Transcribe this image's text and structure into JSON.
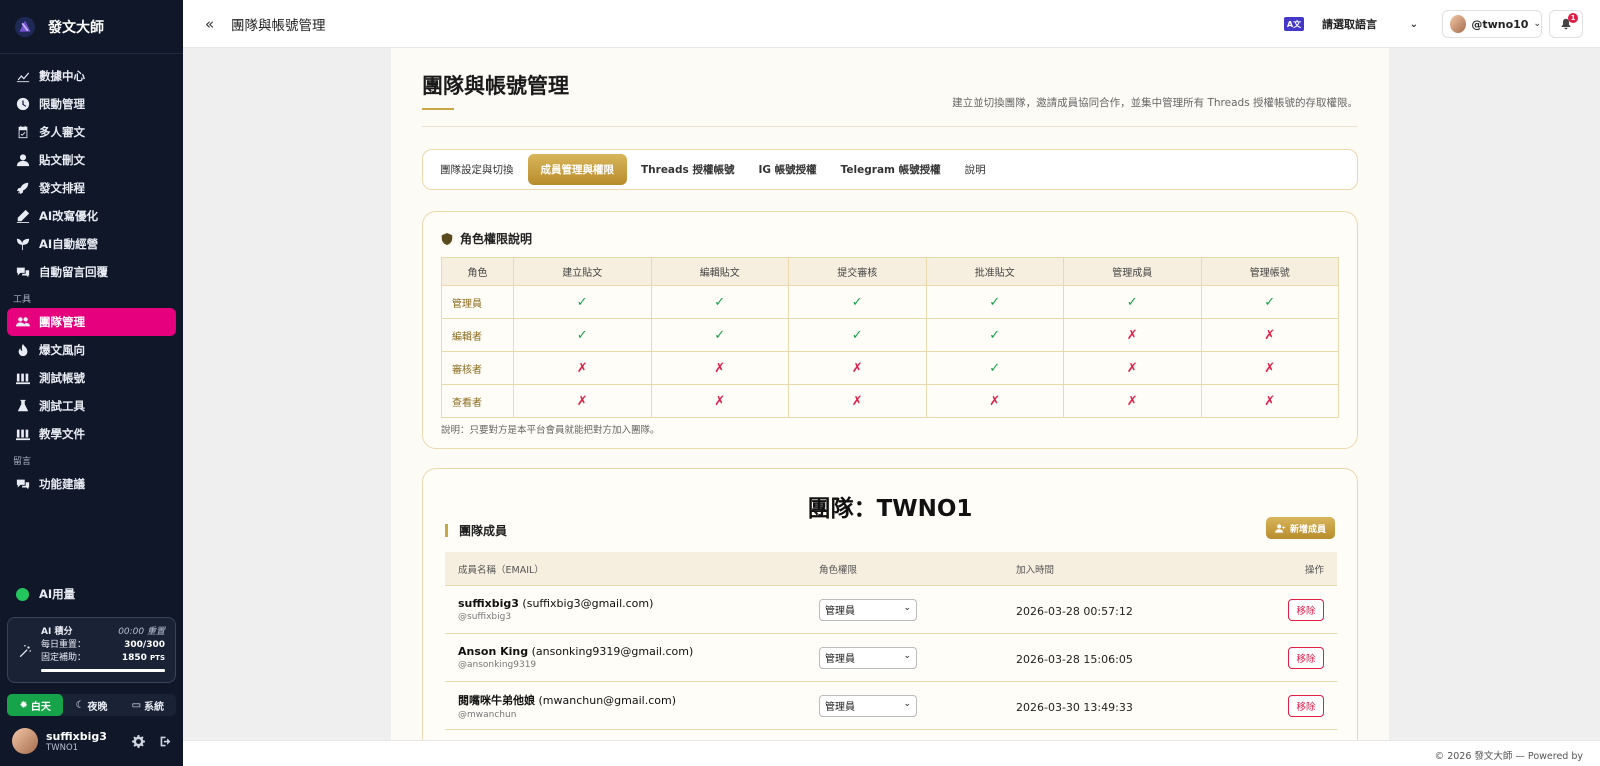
{
  "brand": {
    "name": "發文大師"
  },
  "nav": {
    "items": [
      {
        "label": "數據中心",
        "icon": "chart-line-icon"
      },
      {
        "label": "限動管理",
        "icon": "clock-icon"
      },
      {
        "label": "多人審文",
        "icon": "calendar-check-icon"
      },
      {
        "label": "貼文刪文",
        "icon": "user-icon"
      },
      {
        "label": "發文排程",
        "icon": "rocket-icon"
      },
      {
        "label": "AI改寫優化",
        "icon": "pen-icon"
      },
      {
        "label": "AI自動經營",
        "icon": "seedling-icon"
      },
      {
        "label": "自動留言回覆",
        "icon": "comments-icon"
      }
    ],
    "section_tools": "工具",
    "tools": [
      {
        "label": "團隊管理",
        "icon": "users-icon",
        "active": true
      },
      {
        "label": "爆文風向",
        "icon": "fire-icon"
      },
      {
        "label": "測試帳號",
        "icon": "flask-icon"
      },
      {
        "label": "測試工具",
        "icon": "beaker-icon"
      },
      {
        "label": "教學文件",
        "icon": "book-icon"
      }
    ],
    "section_feedback": "留言",
    "feedback": [
      {
        "label": "功能建議",
        "icon": "comments-icon"
      }
    ]
  },
  "ai_usage": {
    "label": "AI用量"
  },
  "points": {
    "title": "AI 積分",
    "reset": "00:00 重置",
    "daily_label": "每日重置：",
    "daily_value": "300/300",
    "fixed_label": "固定補助：",
    "fixed_value": "1850",
    "fixed_unit": "PTS",
    "fill_fraction": 1.0
  },
  "theme": {
    "day": "白天",
    "night": "夜晚",
    "system": "系統"
  },
  "user": {
    "name": "suffixbig3",
    "team": "TWNO1"
  },
  "topbar": {
    "title": "團隊與帳號管理",
    "lang_icon": "A文",
    "lang_placeholder": "請選取語言",
    "account": "@twno10",
    "notif_count": "1"
  },
  "page": {
    "title": "團隊與帳號管理",
    "description": "建立並切換團隊，邀請成員協同合作，並集中管理所有 Threads 授權帳號的存取權限。"
  },
  "tabs": [
    {
      "label": "團隊設定與切換",
      "active": false,
      "bold": false
    },
    {
      "label": "成員管理與權限",
      "active": true,
      "bold": true
    },
    {
      "label": "Threads 授權帳號",
      "active": false,
      "bold": true
    },
    {
      "label": "IG 帳號授權",
      "active": false,
      "bold": true
    },
    {
      "label": "Telegram 帳號授權",
      "active": false,
      "bold": true
    },
    {
      "label": "說明",
      "active": false,
      "bold": false
    }
  ],
  "roles": {
    "title": "角色權限說明",
    "columns": [
      "角色",
      "建立貼文",
      "編輯貼文",
      "提交審核",
      "批准貼文",
      "管理成員",
      "管理帳號"
    ],
    "rows": [
      {
        "role": "管理員",
        "perms": [
          true,
          true,
          true,
          true,
          true,
          true
        ]
      },
      {
        "role": "編輯者",
        "perms": [
          true,
          true,
          true,
          true,
          false,
          false
        ]
      },
      {
        "role": "審核者",
        "perms": [
          false,
          false,
          false,
          true,
          false,
          false
        ]
      },
      {
        "role": "查看者",
        "perms": [
          false,
          false,
          false,
          false,
          false,
          false
        ]
      }
    ],
    "note": "說明：只要對方是本平台會員就能把對方加入團隊。"
  },
  "team": {
    "title": "團隊：TWNO1",
    "members_label": "團隊成員",
    "add_label": "新增成員",
    "columns": [
      "成員名稱（EMAIL）",
      "角色權限",
      "加入時間",
      "操作"
    ],
    "members": [
      {
        "name": "suffixbig3",
        "email": "(suffixbig3@gmail.com)",
        "handle": "@suffixbig3",
        "role": "管理員",
        "joined": "2026-03-28 00:57:12",
        "action": "移除"
      },
      {
        "name": "Anson King",
        "email": "(ansonking9319@gmail.com)",
        "handle": "@ansonking9319",
        "role": "管理員",
        "joined": "2026-03-28 15:06:05",
        "action": "移除"
      },
      {
        "name": "閱嘴咪牛弟他娘",
        "email": "(mwanchun@gmail.com)",
        "handle": "@mwanchun",
        "role": "管理員",
        "joined": "2026-03-30 13:49:33",
        "action": "移除"
      }
    ]
  },
  "footer": {
    "text": "© 2026 發文大師 — Powered by"
  },
  "colors": {
    "accent": "#e6007e",
    "gold": "#c9a646",
    "ok": "#16a34a",
    "no": "#e11d48",
    "sidebar": "#0f1729"
  }
}
